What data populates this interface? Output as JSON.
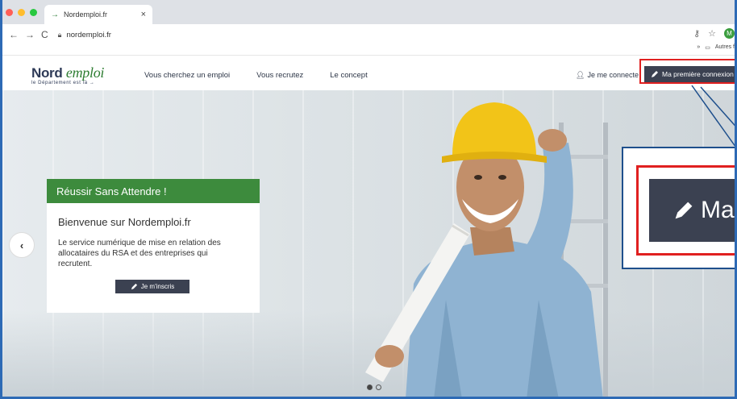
{
  "browser": {
    "tab_title": "Nordemploi.fr",
    "tab_favicon": "→",
    "tab_close": "×",
    "url": "nordemploi.fr",
    "profile_initial": "M",
    "bookmarks_overflow": "»",
    "bookmarks_other": "Autres f",
    "dot_colors": [
      "#ff5f57",
      "#ffbd2e",
      "#28c840"
    ]
  },
  "site": {
    "logo_nord": "Nord",
    "logo_emploi": "emploi",
    "logo_tagline": "le Département est là →",
    "menu": [
      {
        "label": "Vous cherchez un emploi"
      },
      {
        "label": "Vous recrutez"
      },
      {
        "label": "Le concept"
      }
    ],
    "connect_label": "Je me connecte",
    "first_login_label": "Ma première connexion"
  },
  "hero": {
    "banner_title": "Réussir Sans Attendre !",
    "welcome_title": "Bienvenue sur Nordemploi.fr",
    "welcome_text": "Le service numérique de mise en relation des allocataires du RSA et des entreprises qui recrutent.",
    "signup_label": "Je m'inscris",
    "slide_count": 2,
    "active_slide": 1
  },
  "zoom": {
    "label": "Ma première connexion"
  },
  "colors": {
    "accent_green": "#3d8b3d",
    "button_dark": "#3b4151",
    "highlight_red": "#e02020",
    "frame_blue": "#2d6ab5"
  }
}
